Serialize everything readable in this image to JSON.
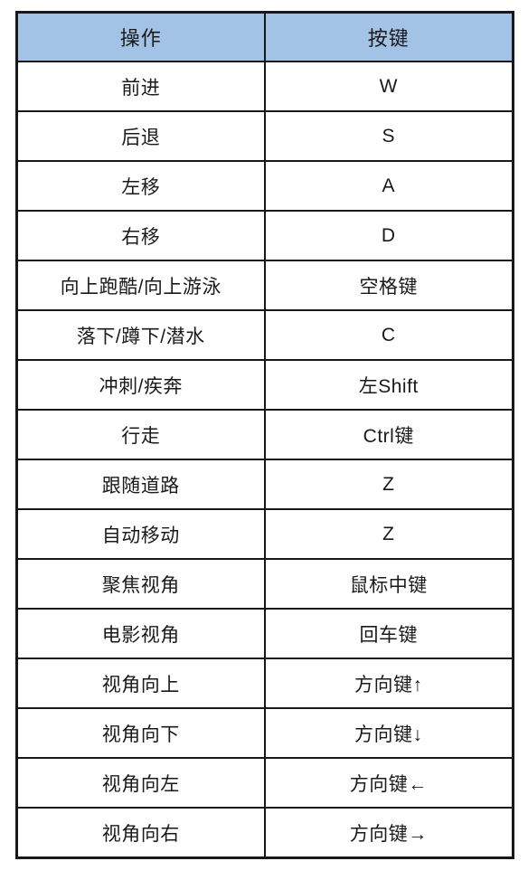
{
  "table": {
    "headers": [
      "操作",
      "按键"
    ],
    "header_background": "#a2c3e6",
    "border_color": "#17171c",
    "rows": [
      {
        "action": "前进",
        "key": "W"
      },
      {
        "action": "后退",
        "key": "S"
      },
      {
        "action": "左移",
        "key": "A"
      },
      {
        "action": "右移",
        "key": "D"
      },
      {
        "action": "向上跑酷/向上游泳",
        "key": "空格键"
      },
      {
        "action": "落下/蹲下/潜水",
        "key": "C"
      },
      {
        "action": "冲刺/疾奔",
        "key": "左Shift"
      },
      {
        "action": "行走",
        "key": "Ctrl键"
      },
      {
        "action": "跟随道路",
        "key": "Z"
      },
      {
        "action": "自动移动",
        "key": "Z"
      },
      {
        "action": "聚焦视角",
        "key": "鼠标中键"
      },
      {
        "action": "电影视角",
        "key": "回车键"
      },
      {
        "action": "视角向上",
        "key": "方向键↑"
      },
      {
        "action": "视角向下",
        "key": "方向键↓"
      },
      {
        "action": "视角向左",
        "key": "方向键←"
      },
      {
        "action": "视角向右",
        "key": "方向键→"
      }
    ]
  }
}
